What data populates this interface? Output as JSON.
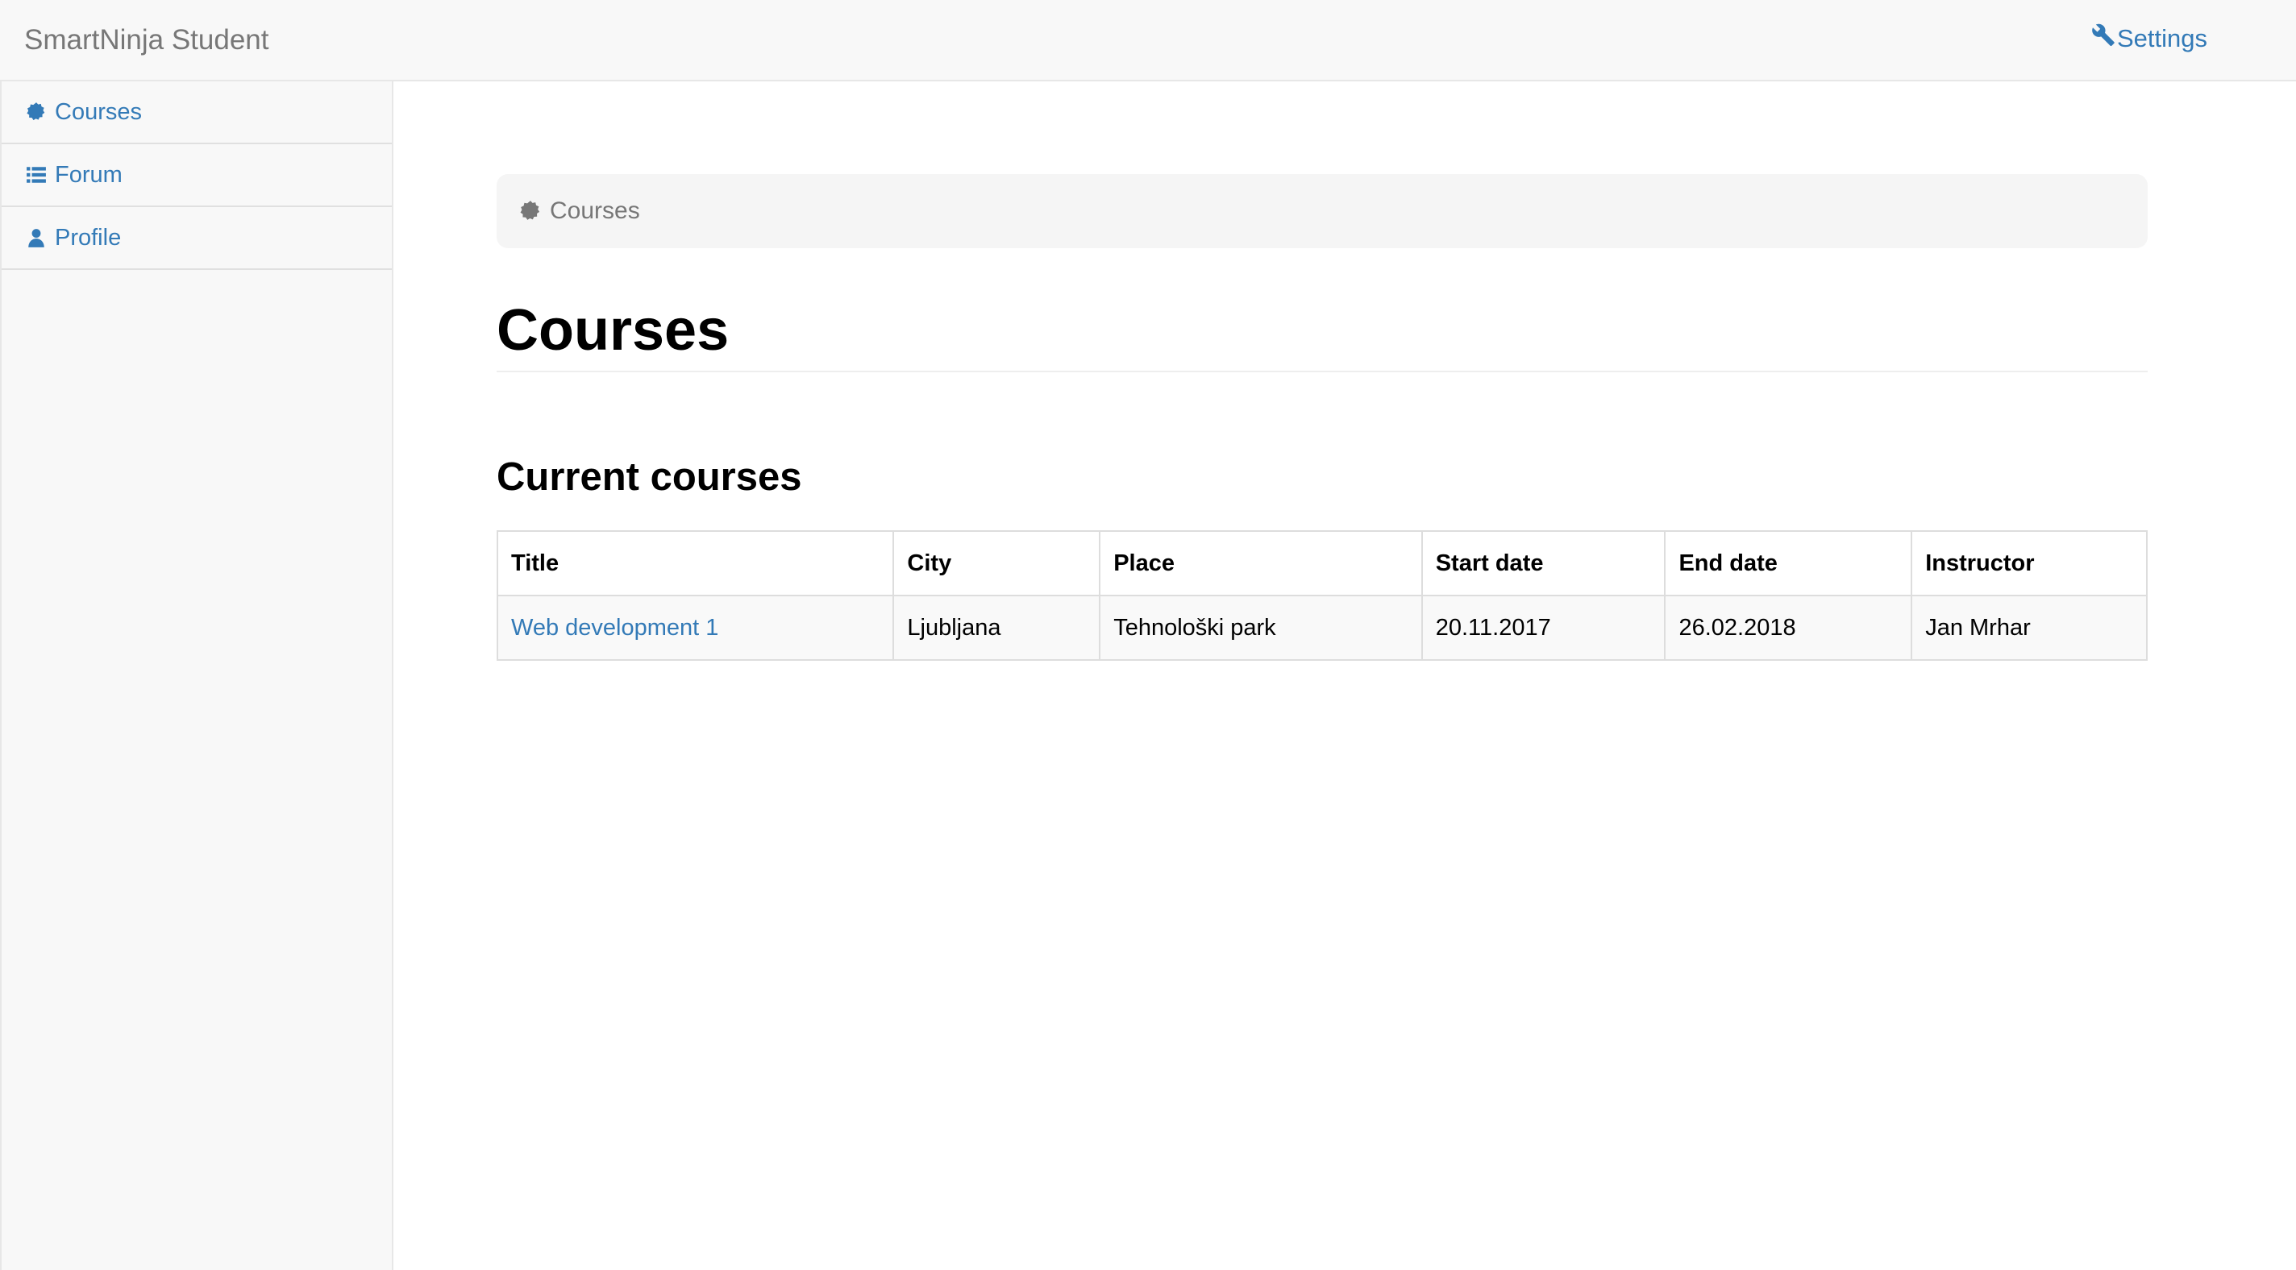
{
  "navbar": {
    "brand": "SmartNinja Student",
    "settings_label": "Settings",
    "settings_icon": "wrench-icon"
  },
  "sidebar": {
    "items": [
      {
        "label": "Courses",
        "icon": "certificate-icon"
      },
      {
        "label": "Forum",
        "icon": "list-icon"
      },
      {
        "label": "Profile",
        "icon": "user-icon"
      }
    ]
  },
  "breadcrumb": {
    "label": "Courses",
    "icon": "certificate-icon"
  },
  "page": {
    "title": "Courses",
    "section_title": "Current courses"
  },
  "table": {
    "headers": [
      "Title",
      "City",
      "Place",
      "Start date",
      "End date",
      "Instructor"
    ],
    "rows": [
      {
        "title": "Web development 1",
        "city": "Ljubljana",
        "place": "Tehnološki park",
        "start_date": "20.11.2017",
        "end_date": "26.02.2018",
        "instructor": "Jan Mrhar"
      }
    ]
  },
  "colors": {
    "link": "#337ab7",
    "navbar_bg": "#f8f8f8",
    "muted_text": "#777777"
  }
}
